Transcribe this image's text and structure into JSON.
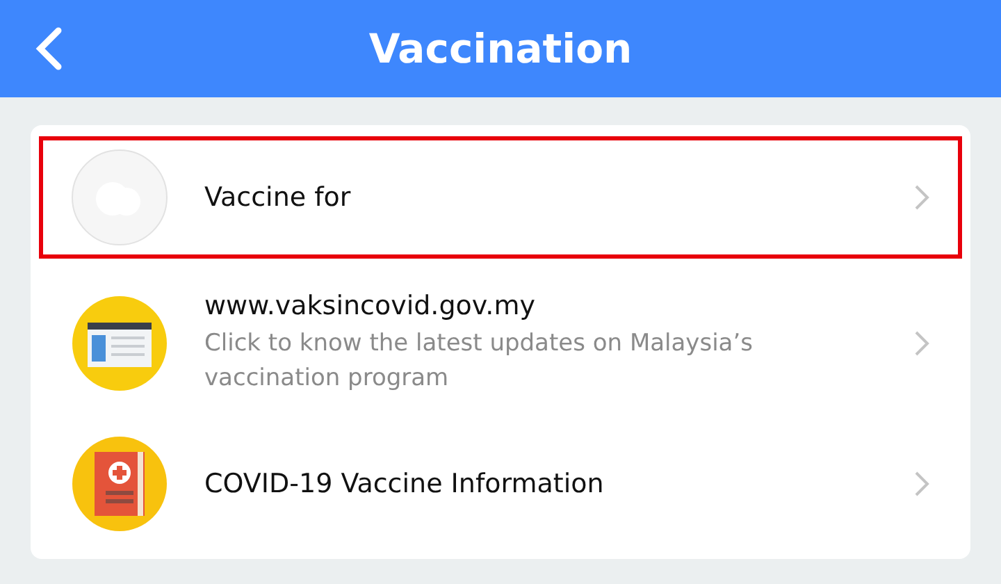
{
  "header": {
    "title": "Vaccination"
  },
  "items": [
    {
      "kind": "blank",
      "title": "Vaccine for",
      "highlighted": true
    },
    {
      "kind": "website",
      "title": "www.vaksincovid.gov.my",
      "subtitle": "Click to know the latest updates on Malaysia’s vaccination program",
      "highlighted": false
    },
    {
      "kind": "info",
      "title": "COVID-19 Vaccine Information",
      "highlighted": false
    }
  ]
}
